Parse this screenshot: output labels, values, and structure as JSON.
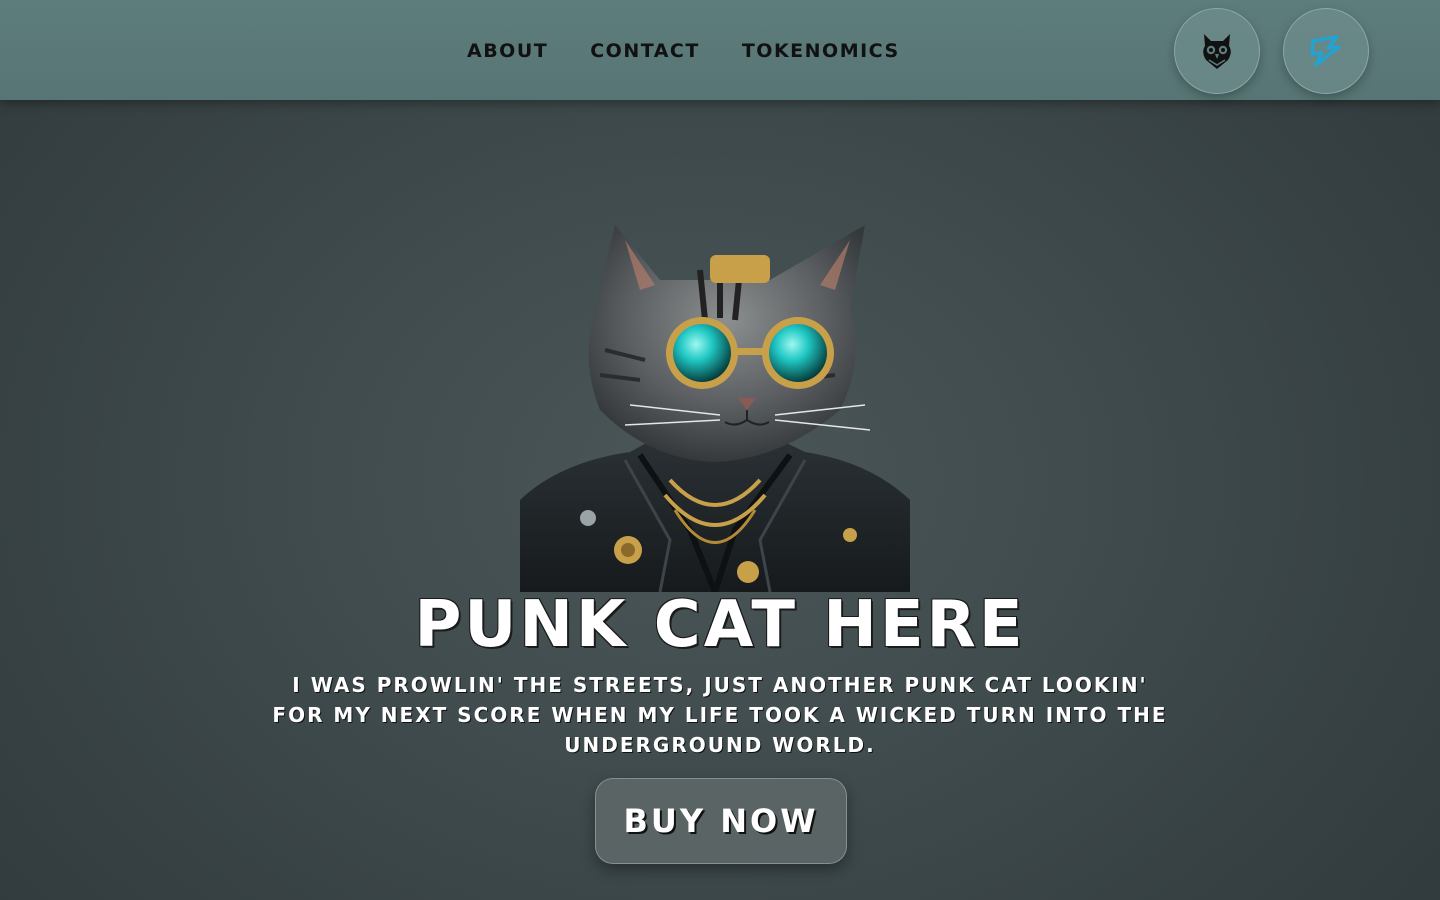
{
  "nav": {
    "items": [
      {
        "label": "About"
      },
      {
        "label": "Contact"
      },
      {
        "label": "Tokenomics"
      }
    ]
  },
  "social": [
    {
      "icon": "owl-icon",
      "color": "#111111"
    },
    {
      "icon": "dex-logo-icon",
      "color": "#1fa4d6"
    }
  ],
  "hero": {
    "image_icon": "punk-cat-image",
    "title": "Punk Cat Here",
    "description": "I was prowlin' the streets, just another punk cat lookin' for my next score when my life took a wicked turn into the underground world.",
    "cta_label": "Buy Now"
  },
  "colors": {
    "header_bg": "#5d7d7c",
    "page_bg": "#3f4b4d",
    "text": "#ffffff",
    "nav_text": "#111111",
    "lens": "#1fc7c4",
    "gold": "#c9a04a"
  }
}
